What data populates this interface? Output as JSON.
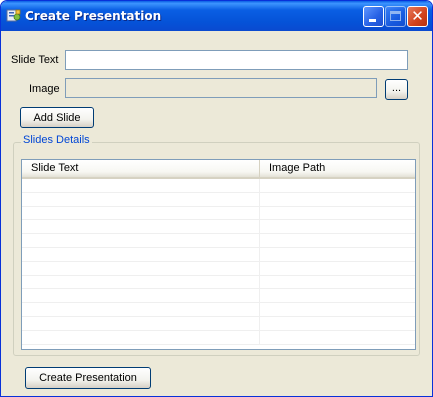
{
  "window": {
    "title": "Create Presentation",
    "icon": "app-icon",
    "controls": [
      "minimize-icon",
      "maximize-icon",
      "close-icon"
    ]
  },
  "form": {
    "slide_text_label": "Slide Text",
    "slide_text_value": "",
    "image_label": "Image",
    "image_value": "",
    "browse_label": "...",
    "add_slide_label": "Add Slide"
  },
  "slides_details": {
    "legend": "Slides Details",
    "columns": [
      "Slide Text",
      "Image Path"
    ],
    "rows": []
  },
  "footer": {
    "create_label": "Create Presentation"
  },
  "colors": {
    "titlebar": "#0a5fe4",
    "window_bg": "#ece9d8",
    "group_legend": "#0046d5",
    "input_border": "#7f9db9",
    "close_button": "#d2421c"
  }
}
